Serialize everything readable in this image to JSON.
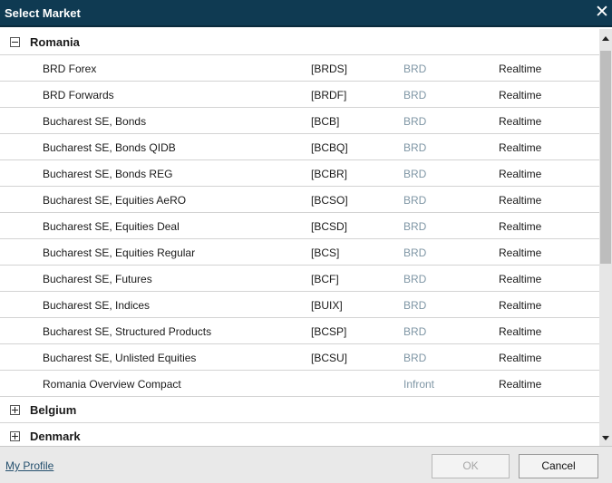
{
  "window": {
    "title": "Select Market",
    "close_glyph": "✕"
  },
  "groups": [
    {
      "name": "Romania",
      "toggle": "minus",
      "items": [
        {
          "name": "BRD Forex",
          "code": "[BRDS]",
          "provider": "BRD",
          "feed": "Realtime"
        },
        {
          "name": "BRD Forwards",
          "code": "[BRDF]",
          "provider": "BRD",
          "feed": "Realtime"
        },
        {
          "name": "Bucharest SE, Bonds",
          "code": "[BCB]",
          "provider": "BRD",
          "feed": "Realtime"
        },
        {
          "name": "Bucharest SE, Bonds QIDB",
          "code": "[BCBQ]",
          "provider": "BRD",
          "feed": "Realtime"
        },
        {
          "name": "Bucharest SE, Bonds REG",
          "code": "[BCBR]",
          "provider": "BRD",
          "feed": "Realtime"
        },
        {
          "name": "Bucharest SE, Equities AeRO",
          "code": "[BCSO]",
          "provider": "BRD",
          "feed": "Realtime"
        },
        {
          "name": "Bucharest SE, Equities Deal",
          "code": "[BCSD]",
          "provider": "BRD",
          "feed": "Realtime"
        },
        {
          "name": "Bucharest SE, Equities Regular",
          "code": "[BCS]",
          "provider": "BRD",
          "feed": "Realtime"
        },
        {
          "name": "Bucharest SE, Futures",
          "code": "[BCF]",
          "provider": "BRD",
          "feed": "Realtime"
        },
        {
          "name": "Bucharest SE, Indices",
          "code": "[BUIX]",
          "provider": "BRD",
          "feed": "Realtime"
        },
        {
          "name": "Bucharest SE, Structured Products",
          "code": "[BCSP]",
          "provider": "BRD",
          "feed": "Realtime"
        },
        {
          "name": "Bucharest SE, Unlisted Equities",
          "code": "[BCSU]",
          "provider": "BRD",
          "feed": "Realtime"
        },
        {
          "name": "Romania Overview Compact",
          "code": "",
          "provider": "Infront",
          "feed": "Realtime"
        }
      ]
    },
    {
      "name": "Belgium",
      "toggle": "plus",
      "items": []
    },
    {
      "name": "Denmark",
      "toggle": "plus",
      "items": []
    }
  ],
  "footer": {
    "profile_link": "My Profile",
    "ok_label": "OK",
    "cancel_label": "Cancel"
  },
  "colors": {
    "titlebar": "#0f3a52",
    "provider_text": "#7f96a5",
    "row_divider": "#d3d3d3"
  },
  "icons": {
    "collapse": "minus-box-icon",
    "expand": "plus-box-icon",
    "close": "close-icon",
    "scroll_up": "chevron-up-icon",
    "scroll_down": "chevron-down-icon"
  }
}
